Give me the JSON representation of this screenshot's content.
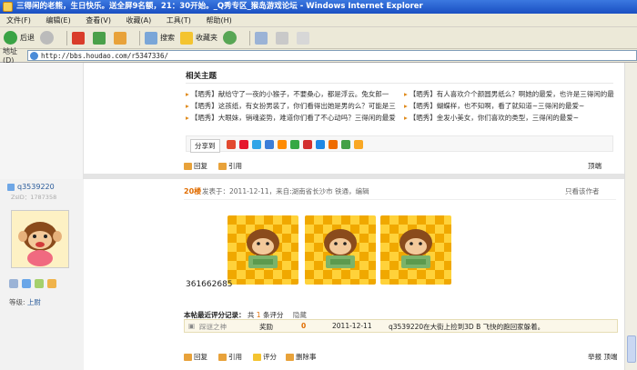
{
  "window": {
    "title": "三得闲的老熊，生日快乐。送全屏9名额，21：30开始。_Q秀专区_猴岛游戏论坛 - Windows Internet Explorer"
  },
  "menu": {
    "items": [
      "文件(F)",
      "编辑(E)",
      "查看(V)",
      "收藏(A)",
      "工具(T)",
      "帮助(H)"
    ]
  },
  "toolbar": {
    "back": "后退",
    "search": "搜索",
    "favorites": "收藏夹"
  },
  "address": {
    "label": "地址(D)",
    "url": "http://bbs.houdao.com/r5347336/"
  },
  "related": {
    "title": "相关主题",
    "items": [
      "【晒秀】献给守了一夜的小猴子，不要桑心，都是浮云。兔女郎一",
      "【晒秀】有人喜欢介个颜圆男纸么？啊她的最爱，也许是三得闲的最",
      "【晒秀】这孩纸，有女扮男装了，你们看得出她是男的么？可能是三",
      "【晒秀】蝴蝶样，也不知啊，看了就知道~三得闲的最爱~",
      "【晒秀】大眼妹，销魂姿势，难道你们看了不心动吗？三得闲的最爱",
      "【晒秀】金发小美女，你们喜欢的类型，三得闲的最爱~"
    ]
  },
  "share": {
    "label": "分享到"
  },
  "post_actions": {
    "reply": "回复",
    "quote": "引用",
    "top": "顶端"
  },
  "user": {
    "name": "q3539220",
    "id": "ZsID：1787358",
    "rank_label": "等级:",
    "rank_value": "上尉"
  },
  "post": {
    "floor": "20楼",
    "meta": "发表于：2011-12-11，来自:湖南省长沙市 铁通，编辑",
    "author_only": "只看该作者",
    "number": "361662685"
  },
  "rating": {
    "label": "本帖最近评分记录：",
    "total_prefix": "共",
    "count": "1",
    "total_suffix": "条评分",
    "hide": "隐藏",
    "row": {
      "user": "踩谜之神",
      "type": "奖励",
      "value": "0",
      "date": "2011-12-11",
      "reason": "q3539220在大街上捡到3D B  飞快的跑回家躲着。"
    }
  },
  "bottom_actions": {
    "reply": "回复",
    "quote": "引用",
    "rate": "评分",
    "delete": "删除事",
    "report": "举报",
    "top": "顶端"
  },
  "colors": {
    "title_blue": "#1a4fc2",
    "accent_orange": "#e06c00",
    "link_blue": "#2b5c9b"
  }
}
